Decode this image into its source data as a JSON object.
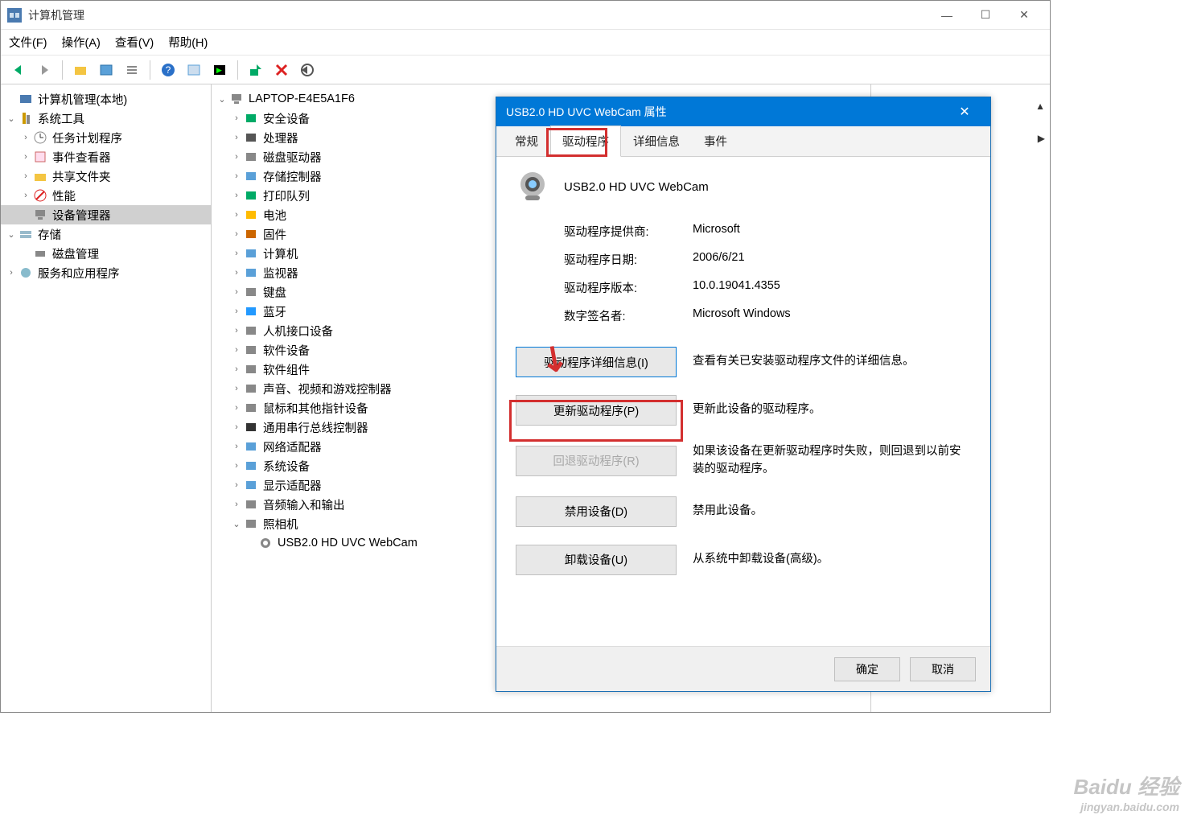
{
  "window": {
    "title": "计算机管理",
    "controls": {
      "minimize": "—",
      "maximize": "☐",
      "close": "✕"
    }
  },
  "menubar": {
    "file": "文件(F)",
    "action": "操作(A)",
    "view": "查看(V)",
    "help": "帮助(H)"
  },
  "left_tree": {
    "root": "计算机管理(本地)",
    "system_tools": "系统工具",
    "task_scheduler": "任务计划程序",
    "event_viewer": "事件查看器",
    "shared_folders": "共享文件夹",
    "performance": "性能",
    "device_manager": "设备管理器",
    "storage": "存储",
    "disk_management": "磁盘管理",
    "services_apps": "服务和应用程序"
  },
  "device_tree": {
    "root": "LAPTOP-E4E5A1F6",
    "items": [
      "安全设备",
      "处理器",
      "磁盘驱动器",
      "存储控制器",
      "打印队列",
      "电池",
      "固件",
      "计算机",
      "监视器",
      "键盘",
      "蓝牙",
      "人机接口设备",
      "软件设备",
      "软件组件",
      "声音、视频和游戏控制器",
      "鼠标和其他指针设备",
      "通用串行总线控制器",
      "网络适配器",
      "系统设备",
      "显示适配器",
      "音频输入和输出",
      "照相机"
    ],
    "camera_child": "USB2.0 HD UVC WebCam"
  },
  "dialog": {
    "title": "USB2.0 HD UVC WebCam 属性",
    "close": "✕",
    "tabs": {
      "general": "常规",
      "driver": "驱动程序",
      "details": "详细信息",
      "events": "事件"
    },
    "device_name": "USB2.0 HD UVC WebCam",
    "info": {
      "provider_label": "驱动程序提供商:",
      "provider_value": "Microsoft",
      "date_label": "驱动程序日期:",
      "date_value": "2006/6/21",
      "version_label": "驱动程序版本:",
      "version_value": "10.0.19041.4355",
      "signer_label": "数字签名者:",
      "signer_value": "Microsoft Windows"
    },
    "buttons": {
      "driver_details": "驱动程序详细信息(I)",
      "driver_details_desc": "查看有关已安装驱动程序文件的详细信息。",
      "update_driver": "更新驱动程序(P)",
      "update_driver_desc": "更新此设备的驱动程序。",
      "rollback": "回退驱动程序(R)",
      "rollback_desc": "如果该设备在更新驱动程序时失败，则回退到以前安装的驱动程序。",
      "disable": "禁用设备(D)",
      "disable_desc": "禁用此设备。",
      "uninstall": "卸载设备(U)",
      "uninstall_desc": "从系统中卸载设备(高级)。"
    },
    "footer": {
      "ok": "确定",
      "cancel": "取消"
    }
  },
  "watermark": {
    "main": "Baidu 经验",
    "sub": "jingyan.baidu.com"
  }
}
